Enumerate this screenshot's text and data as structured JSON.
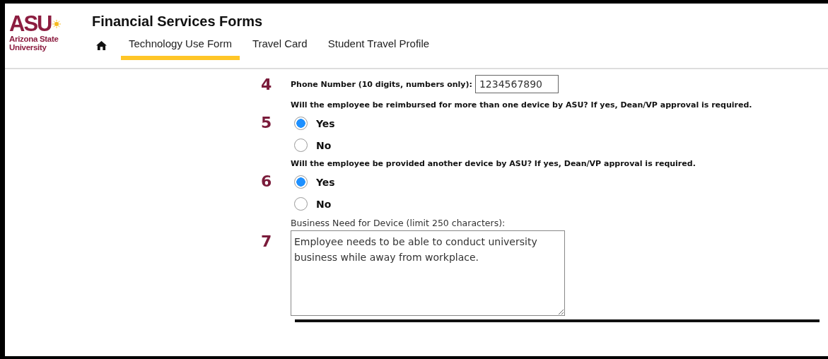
{
  "logo": {
    "mark": "ASU",
    "name": "Arizona State University"
  },
  "header": {
    "title": "Financial Services Forms"
  },
  "tabs": [
    {
      "label": "Technology Use Form",
      "selected": true
    },
    {
      "label": "Travel Card",
      "selected": false
    },
    {
      "label": "Student Travel Profile",
      "selected": false
    }
  ],
  "questions": [
    {
      "kind": "text",
      "number": "4",
      "label": "Phone Number (10 digits, numbers only):",
      "value": "1234567890"
    },
    {
      "kind": "radio",
      "number": "5",
      "label": "Will the employee be reimbursed for more than one device by ASU? If yes, Dean/VP approval is required.",
      "options": [
        {
          "label": "Yes",
          "selected": true
        },
        {
          "label": "No",
          "selected": false
        }
      ]
    },
    {
      "kind": "radio",
      "number": "6",
      "label": "Will the employee be provided another device by ASU? If yes, Dean/VP approval is required.",
      "options": [
        {
          "label": "Yes",
          "selected": true
        },
        {
          "label": "No",
          "selected": false
        }
      ]
    },
    {
      "kind": "textarea",
      "number": "7",
      "label": "Business Need for Device (limit 250 characters):",
      "value": "Employee needs to be able to conduct university business while away from workplace."
    }
  ]
}
